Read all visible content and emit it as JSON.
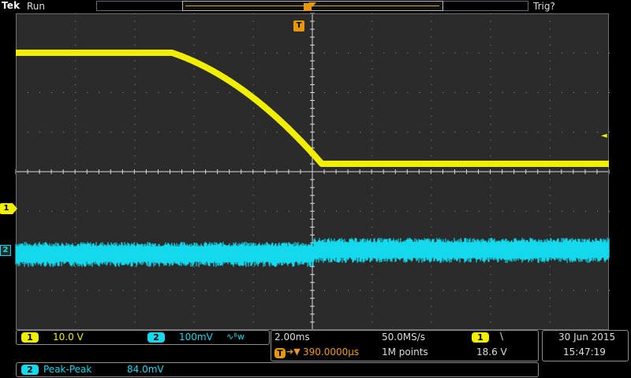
{
  "header": {
    "brand": "Tek",
    "status": "Run",
    "trigger_status": "Trig?"
  },
  "markers": {
    "ch1": "1",
    "ch2": "2",
    "trigger": "T",
    "trigger_level_glyph": "◄"
  },
  "channels": {
    "ch1": {
      "badge": "1",
      "scale": "10.0 V",
      "color": "#f2ee00"
    },
    "ch2": {
      "badge": "2",
      "scale": "100mV",
      "coupling_icon": "∿ᴮw",
      "color": "#14d8ec"
    }
  },
  "timebase": {
    "scale": "2.00ms",
    "sample_rate": "50.0MS/s",
    "trigger_prefix": "T",
    "trigger_arrow": "➔▼",
    "trigger_position": "390.0000µs",
    "record_length": "1M points",
    "trigger_source_badge": "1",
    "trigger_slope": "\\",
    "trigger_level": "18.6 V"
  },
  "datetime": {
    "date": "30 Jun  2015",
    "time": "15:47:19"
  },
  "measurement": {
    "badge": "2",
    "name": "Peak-Peak",
    "value": "84.0mV"
  },
  "waveforms": {
    "ch1_color": "#f2ee00",
    "ch2_color": "#14d8ec",
    "grid_color": "#9a9a9a",
    "background": "#2b2b2b"
  }
}
